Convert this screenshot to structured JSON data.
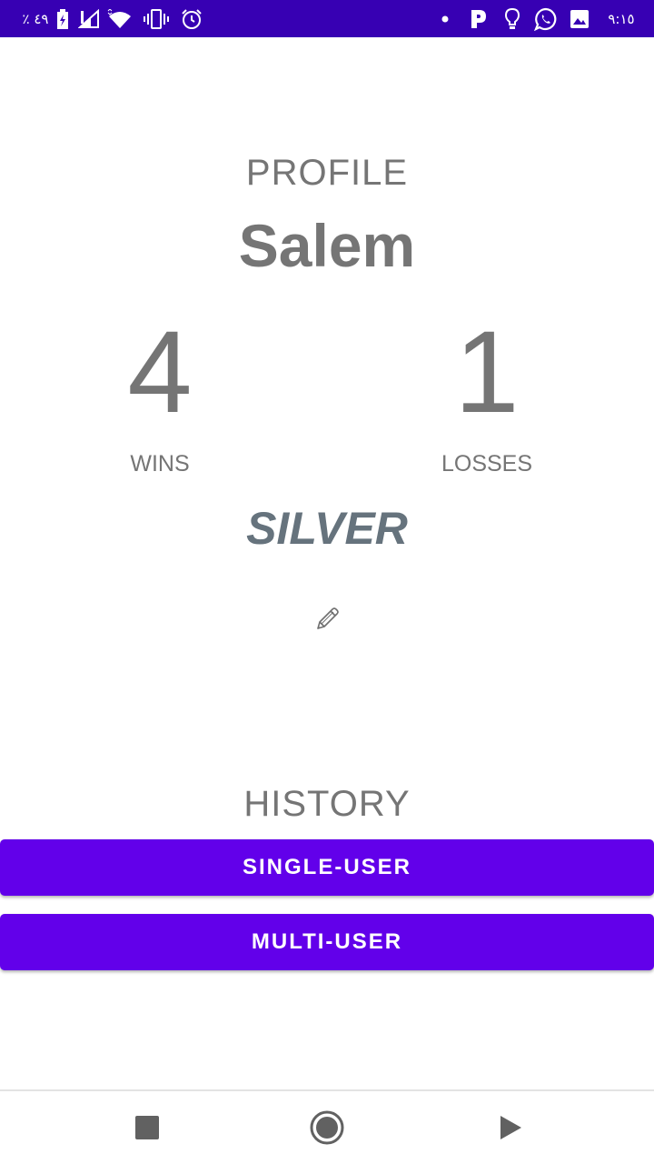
{
  "status_bar": {
    "battery_percent": "٪ ٤٩",
    "time": "٩:١٥",
    "icons": [
      "battery-icon",
      "signal-icon",
      "wifi-icon",
      "vibrate-icon",
      "alarm-icon",
      "notification-dot-icon",
      "parking-app-icon",
      "lightbulb-icon",
      "whatsapp-icon",
      "image-icon"
    ]
  },
  "profile": {
    "title": "PROFILE",
    "name": "Salem",
    "wins_value": "4",
    "wins_label": "WINS",
    "losses_value": "1",
    "losses_label": "LOSSES",
    "rank": "SILVER",
    "edit_icon": "pencil-icon"
  },
  "history": {
    "title": "HISTORY",
    "single_user_label": "SINGLE-USER",
    "multi_user_label": "MULTI-USER"
  },
  "nav_bar": {
    "icons": [
      "stop-icon",
      "home-record-icon",
      "play-icon"
    ]
  },
  "colors": {
    "status_bar": "#3700b3",
    "button": "#6200ea",
    "text_gray": "#757575",
    "rank_text": "#66737d"
  }
}
